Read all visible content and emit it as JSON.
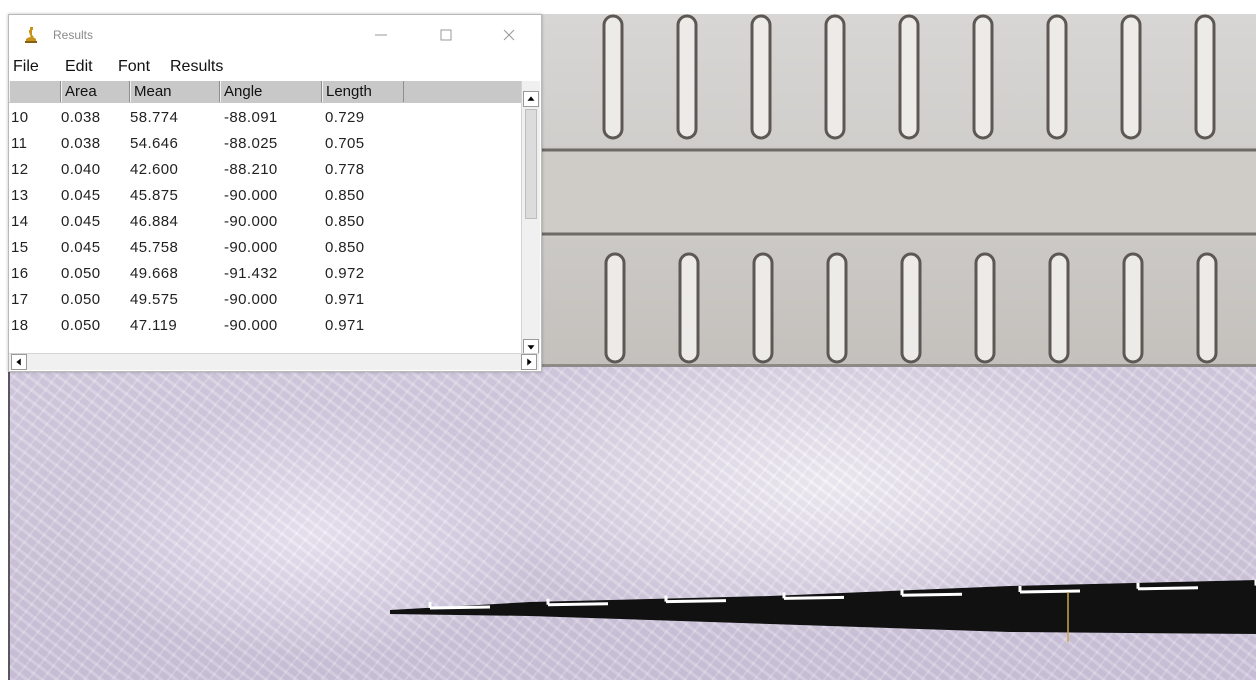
{
  "window": {
    "title": "Results",
    "controls": [
      "minimize",
      "maximize",
      "close"
    ]
  },
  "menu": [
    "File",
    "Edit",
    "Font",
    "Results"
  ],
  "table": {
    "columns": [
      "",
      "Area",
      "Mean",
      "Angle",
      "Length"
    ],
    "rows": [
      [
        "10",
        "0.038",
        "58.774",
        "-88.091",
        "0.729"
      ],
      [
        "11",
        "0.038",
        "54.646",
        "-88.025",
        "0.705"
      ],
      [
        "12",
        "0.040",
        "42.600",
        "-88.210",
        "0.778"
      ],
      [
        "13",
        "0.045",
        "45.875",
        "-90.000",
        "0.850"
      ],
      [
        "14",
        "0.045",
        "46.884",
        "-90.000",
        "0.850"
      ],
      [
        "15",
        "0.045",
        "45.758",
        "-90.000",
        "0.850"
      ],
      [
        "16",
        "0.050",
        "49.668",
        "-91.432",
        "0.972"
      ],
      [
        "17",
        "0.050",
        "49.575",
        "-90.000",
        "0.971"
      ],
      [
        "18",
        "0.050",
        "47.119",
        "-90.000",
        "0.971"
      ]
    ]
  },
  "icons": {
    "app": "microscope-icon",
    "minimize": "minimize-icon",
    "maximize": "maximize-icon",
    "close": "close-icon"
  },
  "colors": {
    "header_bg": "#c8c8c8",
    "scene_bg": "#d7d0e0",
    "needle": "#111111",
    "app_icon": "#c8931a"
  }
}
